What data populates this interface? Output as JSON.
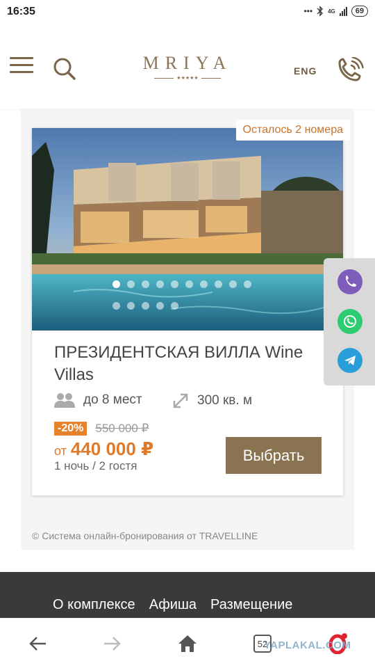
{
  "status": {
    "time": "16:35",
    "network": "4G",
    "battery": "69"
  },
  "header": {
    "logo": "MRIYA",
    "logo_stars": "★★★★★",
    "lang": "ENG"
  },
  "room": {
    "rooms_left_badge": "Осталось 2 номера",
    "title": "ПРЕЗИДЕНТСКАЯ ВИЛЛА Wine Villas",
    "capacity": "до 8 мест",
    "area": "300 кв. м",
    "discount": "-20%",
    "old_price": "550 000 ₽",
    "price_prefix": "от",
    "price": "440 000 ₽",
    "stay_info": "1 ночь / 2 гостя",
    "select_label": "Выбрать",
    "photo_count": 15,
    "active_photo": 1
  },
  "widget_footer": "© Система онлайн-бронирования от TRAVELLINE",
  "footer_nav": [
    "О комплексе",
    "Афиша",
    "Размещение"
  ],
  "browser": {
    "tab_count": "52",
    "watermark": "YAPLAKAL.COM"
  },
  "colors": {
    "brand": "#8a7558",
    "accent": "#e6812c",
    "viber": "#7d5cba",
    "whatsapp": "#2ecc71",
    "telegram": "#2a9ed8"
  }
}
